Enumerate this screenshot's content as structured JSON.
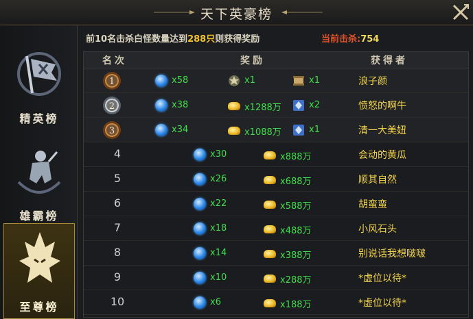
{
  "window": {
    "title": "天下英豪榜",
    "close_icon": "close-icon"
  },
  "sidebar": {
    "tabs": [
      {
        "label": "精英榜",
        "icon": "flag-icon",
        "selected": false
      },
      {
        "label": "雄霸榜",
        "icon": "warrior-icon",
        "selected": false
      },
      {
        "label": "至尊榜",
        "icon": "demon-helmet-icon",
        "selected": true
      }
    ]
  },
  "notice": {
    "prefix": "前10名击杀白怪数量达到",
    "highlight": "288只",
    "suffix": "则获得奖励"
  },
  "kills": {
    "label": "当前击杀:",
    "value": "754"
  },
  "table": {
    "headers": {
      "rank": "名次",
      "reward": "奖励",
      "winner": "获得者"
    },
    "rows": [
      {
        "rank": "1",
        "medal": "bronze-medal",
        "rewards": [
          {
            "icon": "blue-gem-icon",
            "qty": "x58"
          },
          {
            "icon": "emblem-icon",
            "qty": "x1"
          },
          {
            "icon": "scroll-icon",
            "qty": "x1"
          }
        ],
        "name": "浪子颜"
      },
      {
        "rank": "2",
        "medal": "silver-medal",
        "rewards": [
          {
            "icon": "blue-gem-icon",
            "qty": "x38"
          },
          {
            "icon": "gold-ingot-icon",
            "qty": "x1288万"
          },
          {
            "icon": "crystal-icon",
            "qty": "x2"
          }
        ],
        "name": "愤怒的啊牛"
      },
      {
        "rank": "3",
        "medal": "bronze-medal",
        "rewards": [
          {
            "icon": "blue-gem-icon",
            "qty": "x34"
          },
          {
            "icon": "gold-ingot-icon",
            "qty": "x1088万"
          },
          {
            "icon": "crystal-icon",
            "qty": "x1"
          }
        ],
        "name": "清一大美妞"
      },
      {
        "rank": "4",
        "rewards": [
          {
            "icon": "blue-gem-icon",
            "qty": "x30"
          },
          {
            "icon": "gold-ingot-icon",
            "qty": "x888万"
          }
        ],
        "name": "会动的黄瓜"
      },
      {
        "rank": "5",
        "rewards": [
          {
            "icon": "blue-gem-icon",
            "qty": "x26"
          },
          {
            "icon": "gold-ingot-icon",
            "qty": "x688万"
          }
        ],
        "name": "顺其自然"
      },
      {
        "rank": "6",
        "rewards": [
          {
            "icon": "blue-gem-icon",
            "qty": "x22"
          },
          {
            "icon": "gold-ingot-icon",
            "qty": "x588万"
          }
        ],
        "name": "胡蛮蛮"
      },
      {
        "rank": "7",
        "rewards": [
          {
            "icon": "blue-gem-icon",
            "qty": "x18"
          },
          {
            "icon": "gold-ingot-icon",
            "qty": "x488万"
          }
        ],
        "name": "小风石头"
      },
      {
        "rank": "8",
        "rewards": [
          {
            "icon": "blue-gem-icon",
            "qty": "x14"
          },
          {
            "icon": "gold-ingot-icon",
            "qty": "x388万"
          }
        ],
        "name": "别说话我想啵啵"
      },
      {
        "rank": "9",
        "rewards": [
          {
            "icon": "blue-gem-icon",
            "qty": "x10"
          },
          {
            "icon": "gold-ingot-icon",
            "qty": "x288万"
          }
        ],
        "name": "*虚位以待*"
      },
      {
        "rank": "10",
        "rewards": [
          {
            "icon": "blue-gem-icon",
            "qty": "x6"
          },
          {
            "icon": "gold-ingot-icon",
            "qty": "x188万"
          }
        ],
        "name": "*虚位以待*"
      }
    ]
  }
}
